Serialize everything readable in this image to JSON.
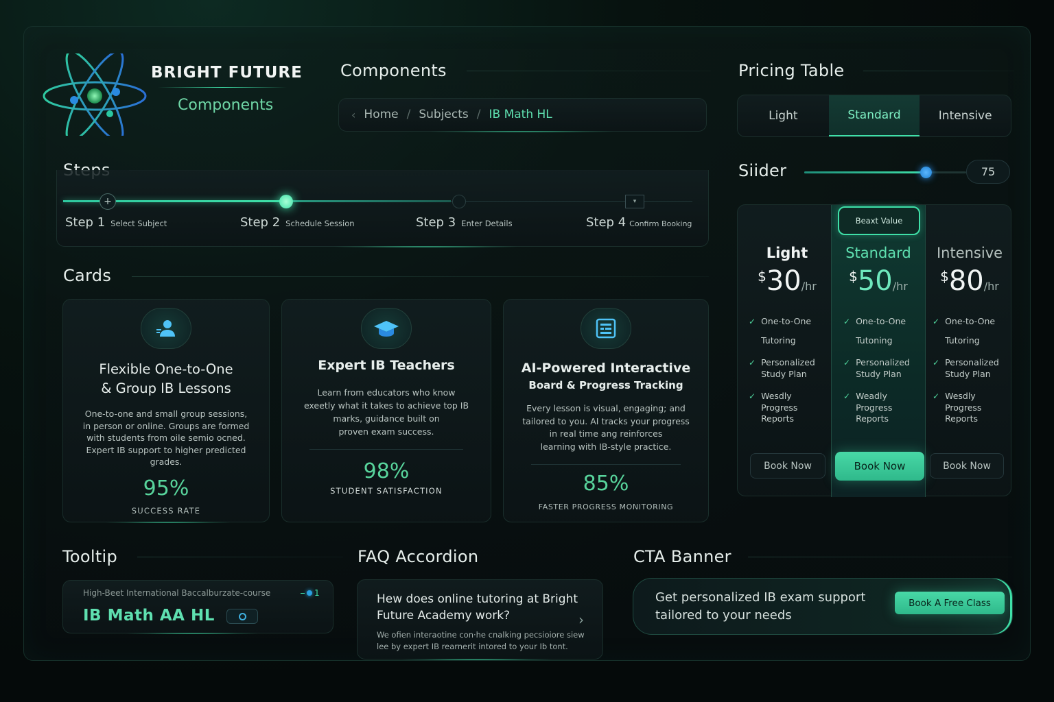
{
  "brand": {
    "name": "BRIGHT FUTURE",
    "subtitle": "Components"
  },
  "sections": {
    "components": "Components",
    "pricing_table": "Pricing Table",
    "steps": "Steps",
    "slider": "Siider",
    "cards": "Cards",
    "tooltip": "Tooltip",
    "faq": "FAQ Accordion",
    "cta": "CTA Banner"
  },
  "breadcrumb": {
    "back": "‹",
    "items": [
      "Home",
      "Subjects",
      "IB Math HL"
    ],
    "separator": "/"
  },
  "pricing_tabs": [
    "Light",
    "Standard",
    "Intensive"
  ],
  "pricing_tab_active": "Standard",
  "slider": {
    "value": "75",
    "fraction": 0.75
  },
  "steps": [
    {
      "label": "Step",
      "num": "1",
      "sub": "Select Subject"
    },
    {
      "label": "Step",
      "num": "2",
      "sub": "Schedule Session"
    },
    {
      "label": "Step",
      "num": "3",
      "sub": "Enter Details"
    },
    {
      "label": "Step",
      "num": "4",
      "sub": "Confirm Booking"
    }
  ],
  "cards": [
    {
      "icon": "user-icon",
      "title1": "Flexible One-to-One",
      "title2": "& Group IB Lessons",
      "lines": [
        "One-to-one and small group sessions,",
        "in person or online. Groups are formed",
        "with students from oile semio ocned.",
        "Expert IB support to higher predicted",
        "grades."
      ],
      "stat": "95%",
      "stat_label": "SUCCESS RATE"
    },
    {
      "icon": "graduation-cap-icon",
      "title1": "Expert IB Teachers",
      "title2": "",
      "lines": [
        "Learn from educators who know",
        "exeetly what it takes to achieve top IB",
        "marks, guidance built on",
        "proven exam success."
      ],
      "stat": "98%",
      "stat_label": "STUDENT SATISFACTION"
    },
    {
      "icon": "board-icon",
      "title1": "AI-Powered Interactive",
      "title2": "Board & Progress Tracking",
      "lines": [
        "Every lesson is visual, engaging; and",
        "tailored to you. AI tracks your progress",
        "in real time ang reinforces",
        "learning with IB-style practice."
      ],
      "stat": "85%",
      "stat_label": "FASTER PROGRESS MONITORING"
    }
  ],
  "pricing": {
    "badge": "Beaxt Value",
    "plans": [
      {
        "name": "Light",
        "currency": "$",
        "amount": "30",
        "per": "/hr",
        "features": [
          [
            "One-to-One",
            "Tutoring"
          ],
          [
            "Personalized",
            "Study Plan"
          ],
          [
            "Wesdly",
            "Progress",
            "Reports"
          ]
        ],
        "button": "Book Now"
      },
      {
        "name": "Standard",
        "currency": "$",
        "amount": "50",
        "per": "/hr",
        "features": [
          [
            "One-to-One",
            "Tutoning"
          ],
          [
            "Personalized",
            "Study Plan"
          ],
          [
            "Weadly",
            "Progress",
            "Reports"
          ]
        ],
        "button": "Book Now"
      },
      {
        "name": "Intensive",
        "currency": "$",
        "amount": "80",
        "per": "/hr",
        "features": [
          [
            "One-to-One",
            "Tutoring"
          ],
          [
            "Personalized",
            "Study Plan"
          ],
          [
            "Wesdly",
            "Progress",
            "Reports"
          ]
        ],
        "button": "Book Now"
      }
    ]
  },
  "tooltip": {
    "caption": "High-Beet International Baccalburzate-course",
    "badge": "1",
    "title": "IB Math AA HL"
  },
  "faq": {
    "question1": "Hew does online tutoring at Bright",
    "question2": "Future Academy work?",
    "answer1": "We ofien interaotine con·he cnalking pecsioiore siew",
    "answer2": "lee by expert IB rearnerit intored to your Ib tont."
  },
  "cta": {
    "line1": "Get personalized IB exam support",
    "line2": "tailored to your needs",
    "button": "Book A Free Class"
  },
  "colors": {
    "accent": "#3fe0a8",
    "accent_text": "#5fe0b0",
    "background": "#050a0a",
    "panel": "#0f1a1c"
  }
}
